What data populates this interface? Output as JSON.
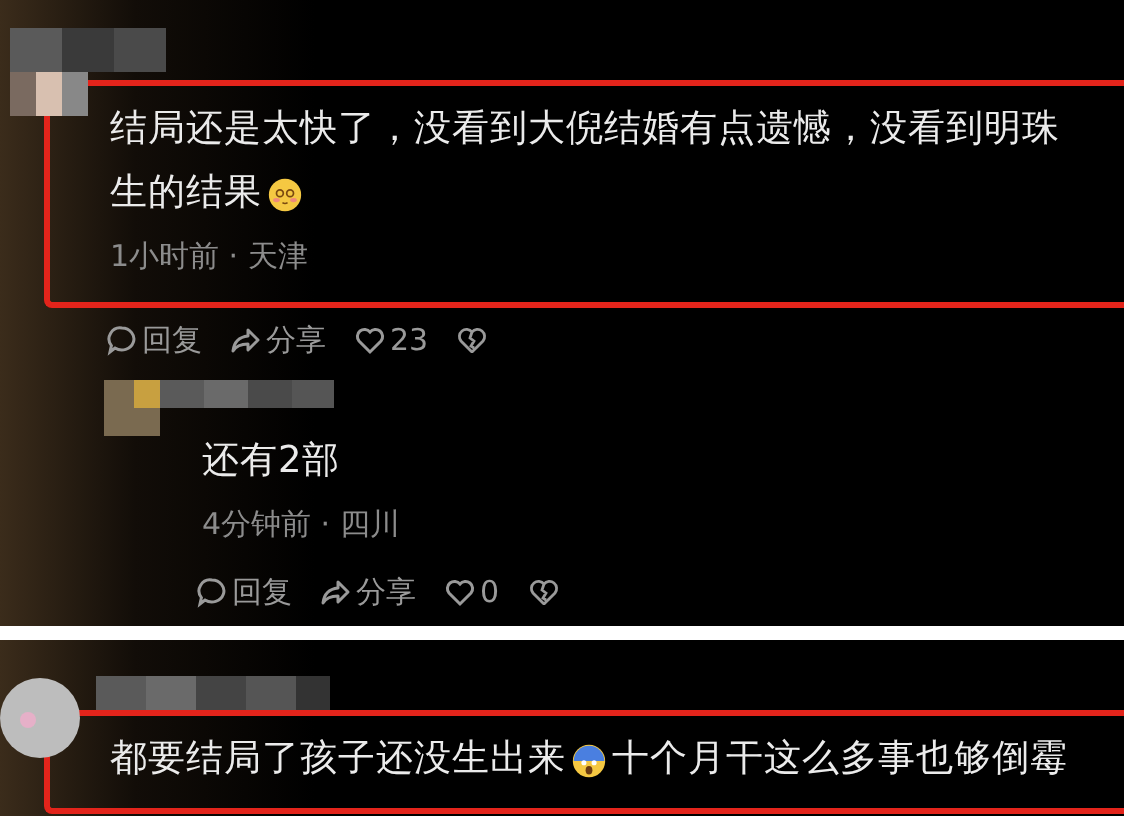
{
  "panels": [
    {
      "comments": [
        {
          "highlighted": true,
          "lines": [
            [
              {
                "kind": "text",
                "text": "结局还是太快了，没看到大倪结婚有点遗憾，没看到明珠"
              }
            ],
            [
              {
                "kind": "text",
                "text": "生的结果"
              },
              {
                "kind": "blush"
              }
            ]
          ],
          "meta": "1小时前 · 天津",
          "actions": {
            "reply": "回复",
            "share": "分享",
            "likes": "23"
          },
          "replies": [
            {
              "highlighted": false,
              "lines": [
                [
                  {
                    "kind": "text",
                    "text": "还有2部"
                  }
                ]
              ],
              "meta": "4分钟前 · 四川",
              "actions": {
                "reply": "回复",
                "share": "分享",
                "likes": "0"
              }
            }
          ]
        }
      ]
    },
    {
      "comments": [
        {
          "highlighted": true,
          "lines": [
            [
              {
                "kind": "text",
                "text": "都要结局了孩子还没生出来"
              },
              {
                "kind": "scared"
              },
              {
                "kind": "text",
                "text": "十个月干这么多事也够倒霉"
              }
            ]
          ]
        }
      ]
    }
  ]
}
